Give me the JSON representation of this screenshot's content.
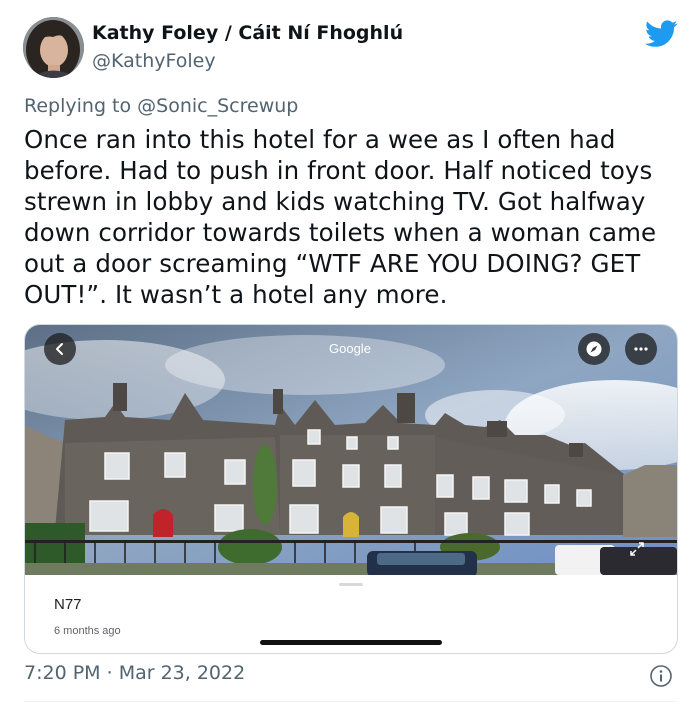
{
  "author": {
    "display_name": "Kathy Foley / Cáit Ní Fhoghlú",
    "handle": "@KathyFoley"
  },
  "reply": {
    "prefix": "Replying to",
    "to": "@Sonic_Screwup"
  },
  "tweet": {
    "text": "Once ran into this hotel for a wee as I often had before. Had to push in front door. Half noticed toys strewn in lobby and kids watching TV. Got halfway down corridor towards toilets when a woman came out a door screaming “WTF ARE YOU DOING? GET OUT!”. It wasn’t a hotel any more."
  },
  "media_card": {
    "provider_label": "Google",
    "place_name": "N77",
    "captured": "6 months ago",
    "icons": [
      "back-arrow-icon",
      "compass-icon",
      "more-options-icon"
    ]
  },
  "footer": {
    "time": "7:20 PM",
    "separator": "·",
    "date": "Mar 23, 2022"
  },
  "colors": {
    "twitter_blue": "#1d9bf0",
    "text_primary": "#0f1419",
    "text_secondary": "#536471",
    "card_border": "#cfd9de"
  },
  "icons": {
    "brand": "twitter-bird-icon",
    "info": "info-icon"
  }
}
